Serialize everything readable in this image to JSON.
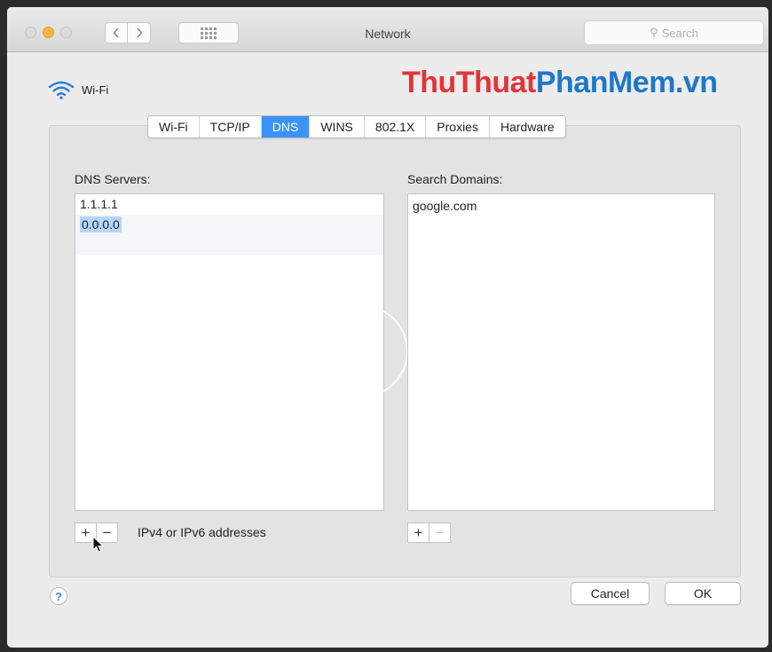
{
  "window": {
    "title": "Network"
  },
  "toolbar": {
    "back_icon": "chevron-left-icon",
    "forward_icon": "chevron-right-icon",
    "grid_icon": "grid-icon",
    "search_placeholder": "Search"
  },
  "interface": {
    "label": "Wi-Fi",
    "icon": "wifi-icon"
  },
  "watermark": {
    "part1": "ThuThuat",
    "part2": "PhanMem.vn"
  },
  "tabs": [
    {
      "label": "Wi-Fi",
      "active": false
    },
    {
      "label": "TCP/IP",
      "active": false
    },
    {
      "label": "DNS",
      "active": true
    },
    {
      "label": "WINS",
      "active": false
    },
    {
      "label": "802.1X",
      "active": false
    },
    {
      "label": "Proxies",
      "active": false
    },
    {
      "label": "Hardware",
      "active": false
    }
  ],
  "dns": {
    "label": "DNS Servers:",
    "servers": [
      "1.1.1.1",
      "0.0.0.0"
    ],
    "hint": "IPv4 or IPv6 addresses",
    "add": "+",
    "remove": "−"
  },
  "search_domains": {
    "label": "Search Domains:",
    "domains": [
      "google.com"
    ],
    "add": "+",
    "remove": "−"
  },
  "footer": {
    "help": "?",
    "cancel": "Cancel",
    "ok": "OK"
  },
  "colors": {
    "accent": "#3b93f5",
    "selection": "#b5d5fb",
    "watermark_red": "#e2343b",
    "watermark_blue": "#1f77c9"
  }
}
